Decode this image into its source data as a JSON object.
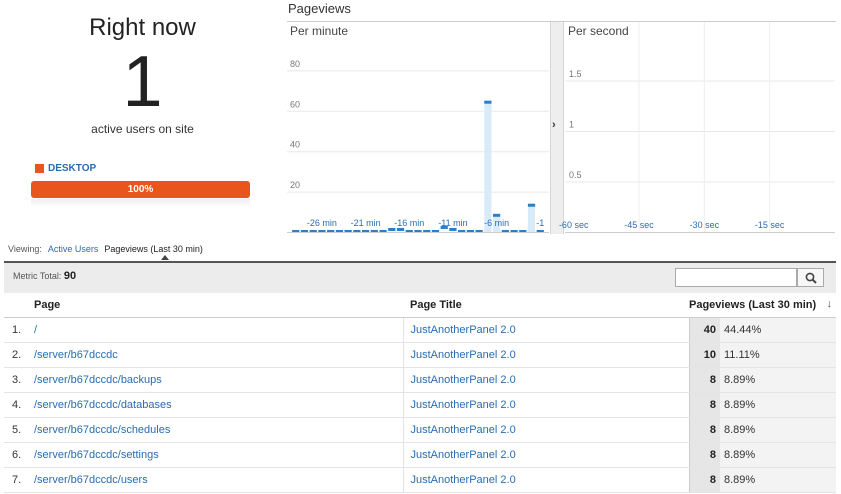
{
  "right_now": {
    "title": "Right now",
    "count": "1",
    "subtitle": "active users on site",
    "device_legend": "DESKTOP",
    "device_percent": "100%",
    "device_color": "#e9561c"
  },
  "pageviews": {
    "title": "Pageviews",
    "per_minute_label": "Per minute",
    "per_second_label": "Per second",
    "bar_color": "#2a80c8"
  },
  "chart_data": [
    {
      "type": "bar",
      "title": "Per minute",
      "ylim": [
        0,
        100
      ],
      "y_ticks": [
        20,
        40,
        60,
        80
      ],
      "x_ticks": [
        "-26 min",
        "-21 min",
        "-16 min",
        "-11 min",
        "-6 min",
        "-1"
      ],
      "x": [
        -29,
        -28,
        -27,
        -26,
        -25,
        -24,
        -23,
        -22,
        -21,
        -20,
        -19,
        -18,
        -17,
        -16,
        -15,
        -14,
        -13,
        -12,
        -11,
        -10,
        -9,
        -8,
        -7,
        -6,
        -5,
        -4,
        -3,
        -2,
        -1
      ],
      "values": [
        1,
        1,
        1,
        1,
        1,
        1,
        1,
        1,
        1,
        1,
        1,
        2,
        2,
        1,
        1,
        1,
        1,
        3,
        2,
        1,
        1,
        1,
        65,
        9,
        1,
        1,
        1,
        14,
        1
      ]
    },
    {
      "type": "bar",
      "title": "Per second",
      "ylim": [
        0,
        2
      ],
      "y_ticks": [
        0.5,
        1,
        1.5
      ],
      "x_ticks": [
        "-60 sec",
        "-45 sec",
        "-30 sec",
        "-15 sec"
      ],
      "values": []
    }
  ],
  "viewing": {
    "label": "Viewing:",
    "tab_active_users": "Active Users",
    "tab_pageviews": "Pageviews (Last 30 min)"
  },
  "metric": {
    "label": "Metric Total:",
    "value": "90",
    "search_placeholder": ""
  },
  "table": {
    "headers": {
      "page": "Page",
      "page_title": "Page Title",
      "pageviews": "Pageviews (Last 30 min)"
    },
    "rows": [
      {
        "idx": "1.",
        "page": "/",
        "title": "JustAnotherPanel 2.0",
        "pageviews": "40",
        "percent": "44.44%"
      },
      {
        "idx": "2.",
        "page": "/server/b67dccdc",
        "title": "JustAnotherPanel 2.0",
        "pageviews": "10",
        "percent": "11.11%"
      },
      {
        "idx": "3.",
        "page": "/server/b67dccdc/backups",
        "title": "JustAnotherPanel 2.0",
        "pageviews": "8",
        "percent": "8.89%"
      },
      {
        "idx": "4.",
        "page": "/server/b67dccdc/databases",
        "title": "JustAnotherPanel 2.0",
        "pageviews": "8",
        "percent": "8.89%"
      },
      {
        "idx": "5.",
        "page": "/server/b67dccdc/schedules",
        "title": "JustAnotherPanel 2.0",
        "pageviews": "8",
        "percent": "8.89%"
      },
      {
        "idx": "6.",
        "page": "/server/b67dccdc/settings",
        "title": "JustAnotherPanel 2.0",
        "pageviews": "8",
        "percent": "8.89%"
      },
      {
        "idx": "7.",
        "page": "/server/b67dccdc/users",
        "title": "JustAnotherPanel 2.0",
        "pageviews": "8",
        "percent": "8.89%"
      }
    ]
  }
}
